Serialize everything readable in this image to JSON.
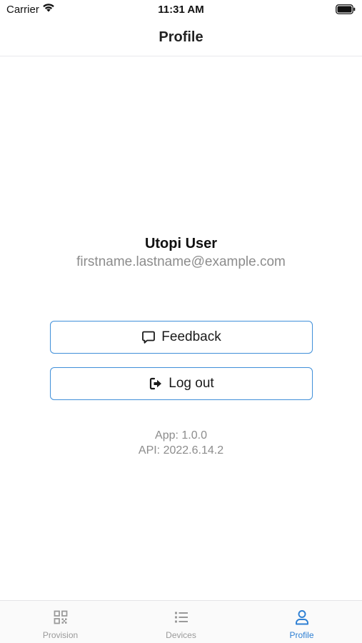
{
  "status_bar": {
    "carrier": "Carrier",
    "time": "11:31 AM"
  },
  "nav": {
    "title": "Profile"
  },
  "profile": {
    "name": "Utopi User",
    "email": "firstname.lastname@example.com"
  },
  "actions": {
    "feedback_label": "Feedback",
    "logout_label": "Log out"
  },
  "versions": {
    "app": "App: 1.0.0",
    "api": "API: 2022.6.14.2"
  },
  "tab_bar": {
    "tabs": [
      {
        "label": "Provision",
        "icon": "qr-code-icon",
        "active": false
      },
      {
        "label": "Devices",
        "icon": "list-icon",
        "active": false
      },
      {
        "label": "Profile",
        "icon": "user-icon",
        "active": true
      }
    ]
  },
  "colors": {
    "accent": "#2d7fd3",
    "button_border": "#3f8fd9",
    "secondary_text": "#8c8c8c",
    "inactive_tab": "#9a9a9a"
  }
}
